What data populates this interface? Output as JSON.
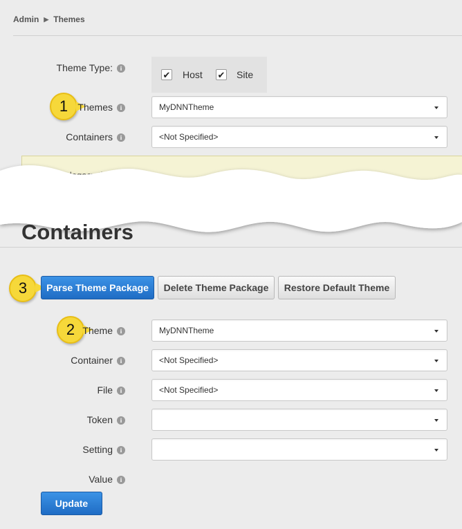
{
  "breadcrumb": {
    "root": "Admin",
    "current": "Themes"
  },
  "top_form": {
    "theme_type_label": "Theme Type:",
    "host_label": "Host",
    "site_label": "Site",
    "themes_label": "Themes",
    "themes_value": "MyDNNTheme",
    "containers_label": "Containers",
    "containers_value": "<Not Specified>"
  },
  "notice": {
    "text": "a legacy theme."
  },
  "section": {
    "heading": "Containers"
  },
  "actions": {
    "parse": "Parse Theme Package",
    "delete": "Delete Theme Package",
    "restore": "Restore Default Theme"
  },
  "bottom_form": {
    "theme_label": "Theme",
    "theme_value": "MyDNNTheme",
    "container_label": "Container",
    "container_value": "<Not Specified>",
    "file_label": "File",
    "file_value": "<Not Specified>",
    "token_label": "Token",
    "token_value": "",
    "setting_label": "Setting",
    "setting_value": "",
    "value_label": "Value"
  },
  "update_button": "Update",
  "callouts": {
    "one": "1",
    "two": "2",
    "three": "3"
  },
  "icons": {
    "info": "info-icon",
    "caret": "caret-down-icon",
    "check": "checkmark-icon"
  },
  "colors": {
    "primary": "#2a7fd8",
    "callout": "#f6d83a",
    "notice_bg": "#f5f3d4"
  }
}
